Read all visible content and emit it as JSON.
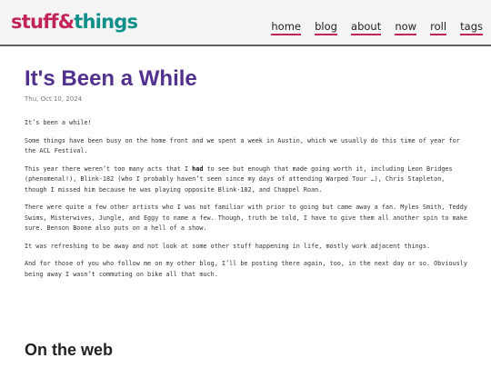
{
  "header": {
    "logo_part1": "stuff",
    "logo_amp": "&",
    "logo_part2": "things",
    "nav": [
      "home",
      "blog",
      "about",
      "now",
      "roll",
      "tags"
    ]
  },
  "post": {
    "title": "It's Been a While",
    "date": "Thu, Oct 10, 2024",
    "paragraphs": [
      "It’s been a while!",
      "Some things have been busy on the home front and we spent a week in Austin, which we usually do this time of year for the ACL Festival.",
      "This year there weren’t too many acts that I ",
      "There were quite a few other artists who I was not familiar with prior to going but came away a fan. Myles Smith, Teddy Swims, Misterwives, Jungle, and Eggy to name a few. Though, truth be told, I have to give them all another spin to make sure. Benson Boone also puts on a hell of a show.",
      "It was refreshing to be away and not look at some other stuff happening in life, mostly work adjacent things.",
      "And for those of you who follow me on my other blog, I’ll be posting there again, too, in the next day or so. Obviously being away I wasn’t commuting on bike all that much."
    ],
    "p3_emph": "had",
    "p3_rest": " to see but enough that made going worth it, including Leon Bridges (phenomenal!), Blink-182 (who I probably haven’t seen since my days of attending Warped Tour …), Chris Stapleton, though I missed him because he was playing opposite Blink-182, and Chappel Roan."
  },
  "section": {
    "heading": "On the web"
  }
}
